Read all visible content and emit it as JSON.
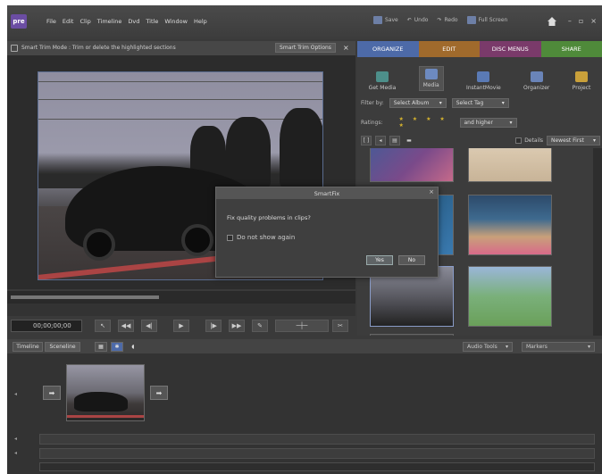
{
  "app": {
    "logo": "pre"
  },
  "menu": [
    "File",
    "Edit",
    "Clip",
    "Timeline",
    "Dvd",
    "Title",
    "Window",
    "Help"
  ],
  "top_actions": {
    "save": "Save",
    "undo": "Undo",
    "redo": "Redo",
    "fullscreen": "Full Screen"
  },
  "trim": {
    "message": "Smart Trim Mode : Trim or delete the highlighted sections",
    "options_label": "Smart Trim Options",
    "close": "×"
  },
  "monitor": {
    "timecode": "00;00;00;00"
  },
  "right_tabs": [
    "ORGANIZE",
    "EDIT",
    "DISC MENUS",
    "SHARE"
  ],
  "right_tools": [
    "Get Media",
    "Media",
    "InstantMovie",
    "Organizer",
    "Project"
  ],
  "filter": {
    "filter_by_label": "Filter by:",
    "album": "Select Album",
    "tag": "Select Tag",
    "ratings_label": "Ratings:",
    "stars": "★ ★ ★ ★ ★",
    "and_higher": "and higher"
  },
  "view": {
    "details_label": "Details",
    "sort": "Newest First"
  },
  "dialog": {
    "title": "SmartFix",
    "message": "Fix quality problems in clips?",
    "checkbox_label": "Do not show again",
    "yes": "Yes",
    "no": "No"
  },
  "bottom": {
    "timeline_tab": "Timeline",
    "sceneline_tab": "Sceneline",
    "audio_tools": "Audio Tools",
    "markers": "Markers"
  },
  "colors": {
    "organize": "#4d6aa8",
    "edit": "#a06a2c",
    "disc_menus": "#7a3a6a",
    "share": "#4f8a3a",
    "logo": "#6b4da3"
  }
}
